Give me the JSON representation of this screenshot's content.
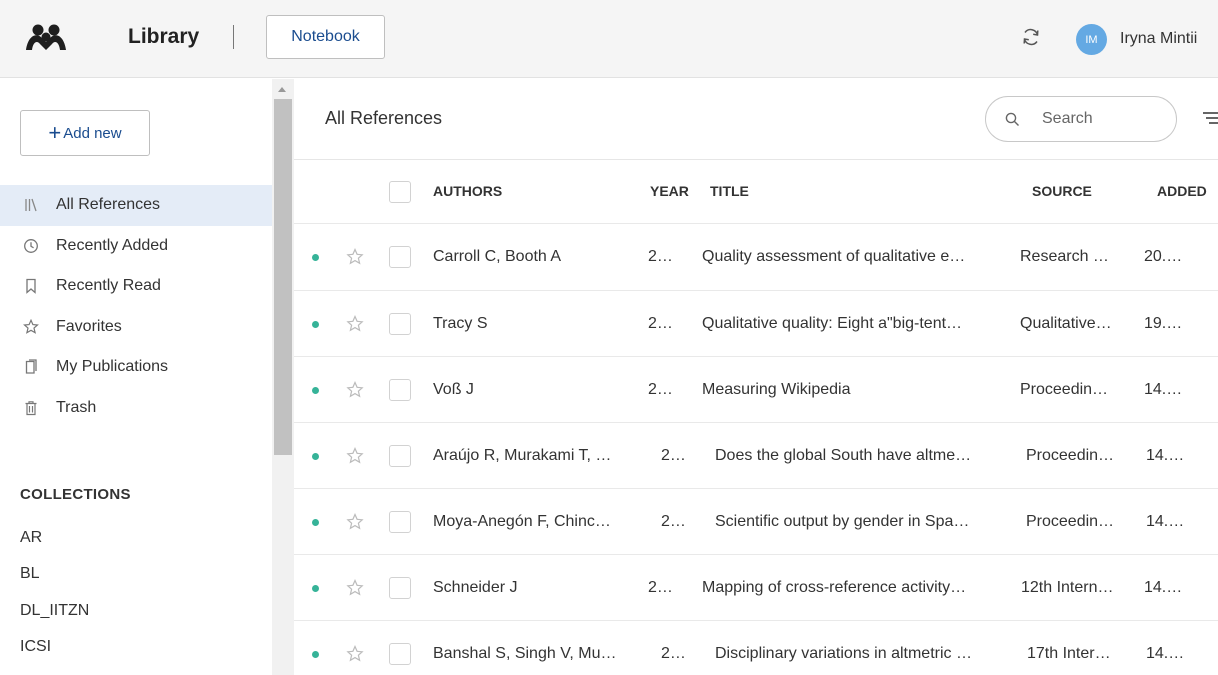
{
  "header": {
    "app_title": "Library",
    "notebook_label": "Notebook",
    "user": {
      "initials": "IM",
      "name": "Iryna Mintii"
    },
    "avatar_color": "#64a9e3"
  },
  "sidebar": {
    "add_new_label": "Add new",
    "items": [
      {
        "label": "All References",
        "icon": "library-icon",
        "active": true
      },
      {
        "label": "Recently Added",
        "icon": "clock-icon",
        "active": false
      },
      {
        "label": "Recently Read",
        "icon": "bookmark-icon",
        "active": false
      },
      {
        "label": "Favorites",
        "icon": "star-icon",
        "active": false
      },
      {
        "label": "My Publications",
        "icon": "publications-icon",
        "active": false
      },
      {
        "label": "Trash",
        "icon": "trash-icon",
        "active": false
      }
    ],
    "collections_heading": "COLLECTIONS",
    "collections": [
      "AR",
      "BL",
      "DL_IITZN",
      "ICSI"
    ]
  },
  "main": {
    "title": "All References",
    "search_placeholder": "Search",
    "columns": {
      "authors": "AUTHORS",
      "year": "YEAR",
      "title": "TITLE",
      "source": "SOURCE",
      "added": "ADDED"
    },
    "rows": [
      {
        "authors": "Carroll C, Booth A",
        "year": "2…",
        "title": "Quality assessment of qualitative e…",
        "source": "Research …",
        "added": "20.…"
      },
      {
        "authors": "Tracy S",
        "year": "2…",
        "title": "Qualitative quality: Eight a\"big-tent…",
        "source": "Qualitative…",
        "added": "19.…"
      },
      {
        "authors": "Voß J",
        "year": "2…",
        "title": "Measuring Wikipedia",
        "source": "Proceedin…",
        "added": "14.…"
      },
      {
        "authors": "Araújo R, Murakami T, …",
        "year": "2…",
        "title": "Does the global South have altme…",
        "source": "Proceedin…",
        "added": "14.…"
      },
      {
        "authors": "Moya-Anegón F, Chinc…",
        "year": "2…",
        "title": "Scientific output by gender in Spa…",
        "source": "Proceedin…",
        "added": "14.…"
      },
      {
        "authors": "Schneider J",
        "year": "2…",
        "title": "Mapping of cross-reference activity…",
        "source": "12th Intern…",
        "added": "14.…"
      },
      {
        "authors": "Banshal S, Singh V, Mu…",
        "year": "2…",
        "title": "Disciplinary variations in altmetric …",
        "source": "17th Inter…",
        "added": "14.…"
      }
    ],
    "unread_dot_color": "#36b398",
    "accent_color": "#1a4c8f"
  }
}
